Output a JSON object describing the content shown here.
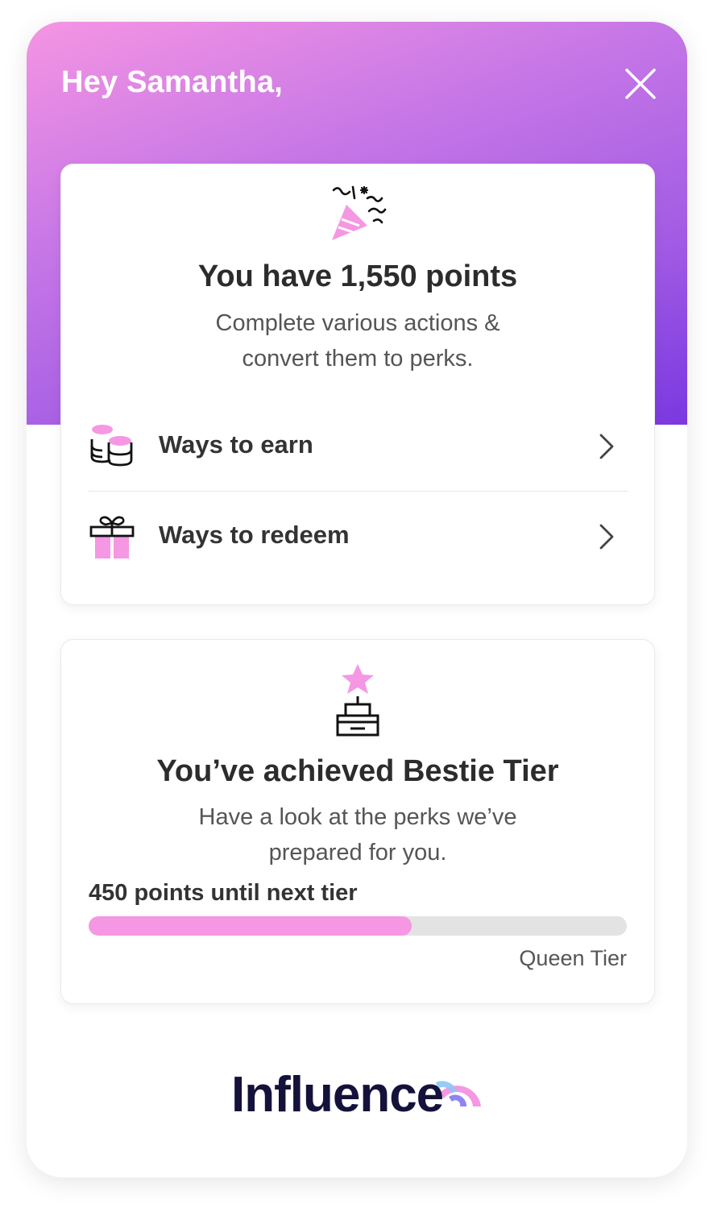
{
  "header": {
    "greeting": "Hey Samantha,",
    "close_icon": "close-icon",
    "gradient_colors": [
      "#f595e3",
      "#a25ce4",
      "#7a38e0"
    ]
  },
  "points_card": {
    "icon": "party-popper-icon",
    "title": "You have 1,550 points",
    "subtitle_line1": "Complete various actions &",
    "subtitle_line2": "convert them to perks.",
    "nav_items": [
      {
        "label": "Ways to earn",
        "icon": "coins-icon"
      },
      {
        "label": "Ways to redeem",
        "icon": "gift-icon"
      }
    ]
  },
  "tier_card": {
    "icon": "star-trophy-icon",
    "title": "You’ve achieved Bestie Tier",
    "subtitle_line1": "Have a look at the perks we’ve",
    "subtitle_line2": "prepared for you.",
    "progress_label": "450 points until next tier",
    "progress_fraction": 0.6,
    "next_tier": "Queen Tier"
  },
  "footer": {
    "brand": "Influence"
  },
  "colors": {
    "accent_pink": "#f597e3",
    "text_dark": "#2c2c2c",
    "brand_navy": "#14123a"
  }
}
